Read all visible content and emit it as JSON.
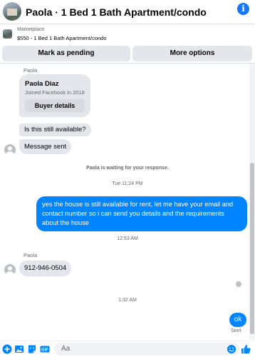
{
  "header": {
    "title": "Paola · 1 Bed 1 Bath Apartment/condo",
    "info_glyph": "i"
  },
  "listing": {
    "source": "Marketplace",
    "description": "$550 - 1 Bed 1 Bath Apartment/condo"
  },
  "actions": {
    "mark_pending": "Mark as pending",
    "more_options": "More options"
  },
  "thread": {
    "sender_label_1": "Paola",
    "card": {
      "name": "Paola Diaz",
      "joined": "Joined Facebook in 2018",
      "button": "Buyer details"
    },
    "msg_available": "Is this still available?",
    "msg_sent": "Message sent",
    "waiting_notice": "Paola is waiting for your response.",
    "time_1": "Tue 11:24 PM",
    "outgoing_1": "yes the house is still available for rent, let me have your email  and contact number so i can send you details and the requirements about the house",
    "time_2": "12:53 AM",
    "sender_label_2": "Paola",
    "msg_phone": "912-946-0504",
    "time_3": "1:32 AM",
    "outgoing_2": "ok",
    "status": "Sent"
  },
  "composer": {
    "placeholder": "Aa",
    "icons": [
      "add-icon",
      "image-icon",
      "sticker-icon",
      "gif-icon",
      "emoji-icon",
      "like-icon"
    ]
  },
  "colors": {
    "brand": "#1877f2",
    "outgoing_bubble": "#0084ff",
    "incoming_bubble": "#e4e6eb"
  }
}
